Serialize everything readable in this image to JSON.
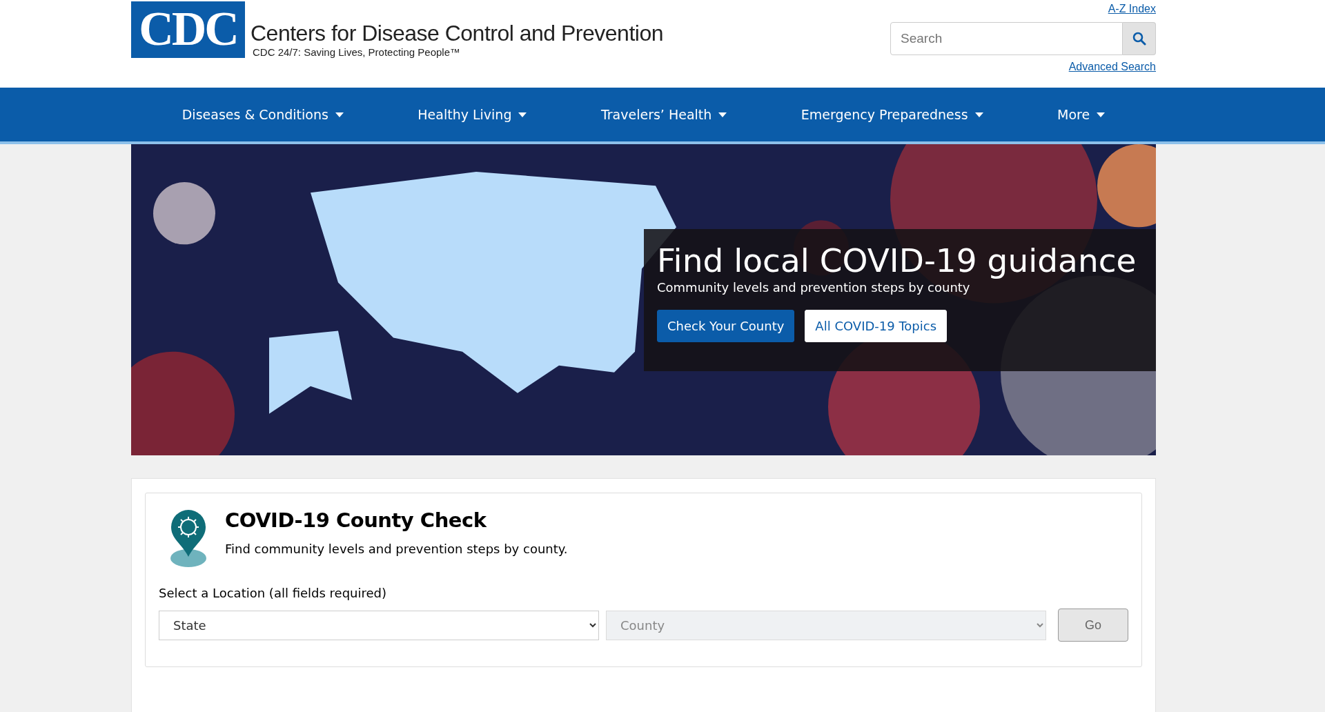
{
  "header": {
    "logo_text": "CDC",
    "title": "Centers for Disease Control and Prevention",
    "tagline": "CDC 24/7: Saving Lives, Protecting People™",
    "az_link": "A-Z Index",
    "search": {
      "placeholder": "Search"
    },
    "advanced_link": "Advanced Search"
  },
  "nav": [
    {
      "label": "Diseases & Conditions",
      "has_menu": true
    },
    {
      "label": "Healthy Living",
      "has_menu": true
    },
    {
      "label": "Travelers’ Health",
      "has_menu": true
    },
    {
      "label": "Emergency Preparedness",
      "has_menu": true
    },
    {
      "label": "More",
      "has_menu": true
    }
  ],
  "hero": {
    "kind": "picture",
    "title": "Find local COVID-19 guidance",
    "subtitle": "Community levels and prevention steps by county",
    "buttons": [
      {
        "label": "Check Your County",
        "kind": "primary"
      },
      {
        "label": "All COVID-19 Topics",
        "kind": "secondary"
      }
    ]
  },
  "county_check": {
    "title": "COVID-19 County Check",
    "description": "Find community levels and prevention steps by county.",
    "location_label": "Select a Location (all fields required)",
    "selects": [
      {
        "value": "State",
        "disabled": false
      },
      {
        "value": "County",
        "disabled": true
      }
    ],
    "go_button": {
      "label": "Go",
      "disabled": true
    }
  }
}
